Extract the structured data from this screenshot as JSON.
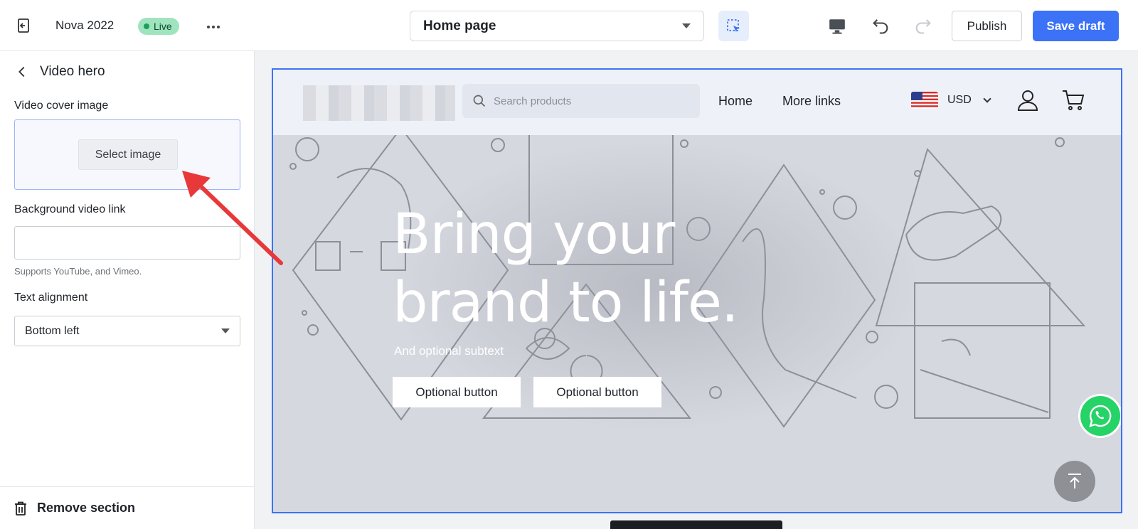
{
  "topbar": {
    "store_name": "Nova 2022",
    "live_label": "Live",
    "page_selector": "Home page",
    "publish_label": "Publish",
    "save_label": "Save draft"
  },
  "sidebar": {
    "title": "Video hero",
    "cover_label": "Video cover image",
    "select_image_label": "Select image",
    "video_link_label": "Background video link",
    "video_link_value": "",
    "video_link_help": "Supports YouTube, and Vimeo.",
    "alignment_label": "Text alignment",
    "alignment_value": "Bottom left",
    "remove_label": "Remove section"
  },
  "preview": {
    "search_placeholder": "Search products",
    "nav": [
      "Home",
      "More links"
    ],
    "currency": "USD",
    "hero_title_line1": "Bring your",
    "hero_title_line2": "brand to life.",
    "hero_subtext": "And optional subtext",
    "buttons": [
      "Optional button",
      "Optional button"
    ]
  },
  "colors": {
    "accent": "#3b72f6",
    "live_badge": "#9fe4bf",
    "whatsapp": "#25d366"
  }
}
